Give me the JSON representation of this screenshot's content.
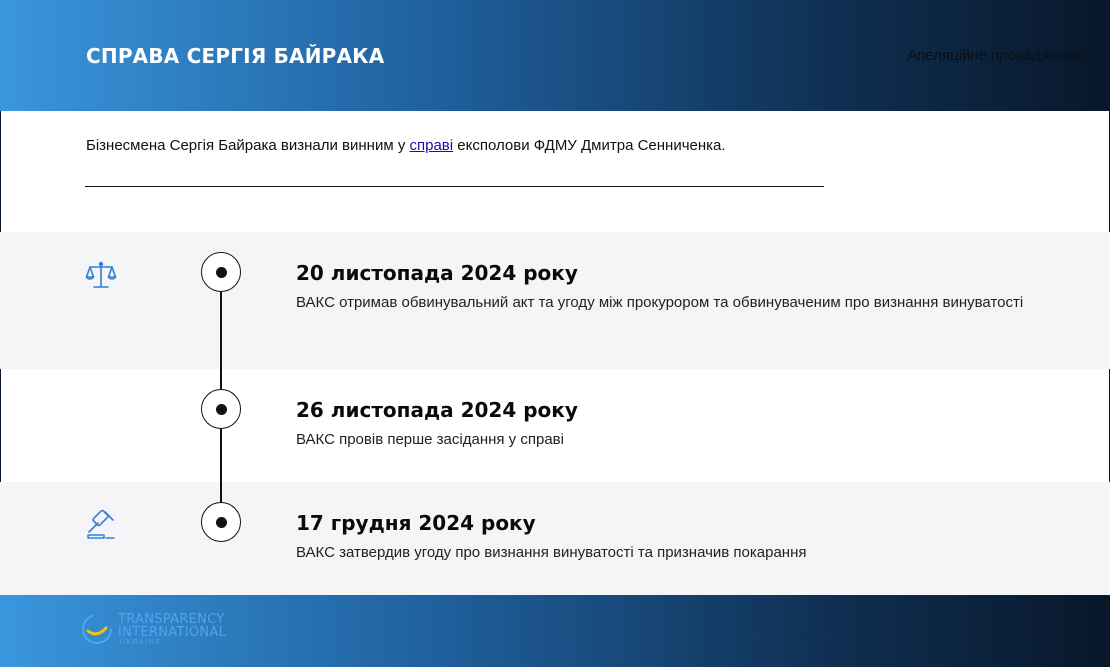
{
  "header": {
    "title": "СПРАВА СЕРГІЯ БАЙРАКА",
    "right_label": "Апеляційне провадження"
  },
  "intro": {
    "before_link": "Бізнесмена Сергія Байрака визнали винним у ",
    "link_text": "справі",
    "after_link": " експолови ФДМУ Дмитра Сенниченка."
  },
  "events": [
    {
      "date": "20 листопада 2024 року",
      "text": "ВАКС отримав обвинувальний акт та угоду між прокурором та обвинуваченим про визнання винуватості",
      "icon": "scales-icon"
    },
    {
      "date": "26 листопада 2024 року",
      "text": "ВАКС провів перше засідання у справі",
      "icon": ""
    },
    {
      "date": "17 грудня 2024 року",
      "text": "ВАКС затвердив угоду про визнання винуватості та призначив покарання",
      "icon": "gavel-icon"
    }
  ],
  "footer": {
    "logo_line1": "TRANSPARENCY",
    "logo_line2": "INTERNATIONAL",
    "logo_line3": "UKRAINE"
  },
  "colors": {
    "accent_blue": "#3a96dd",
    "dark_navy": "#08172a",
    "icon_blue": "#2f7fd6",
    "band_gray": "#f5f5f7"
  }
}
